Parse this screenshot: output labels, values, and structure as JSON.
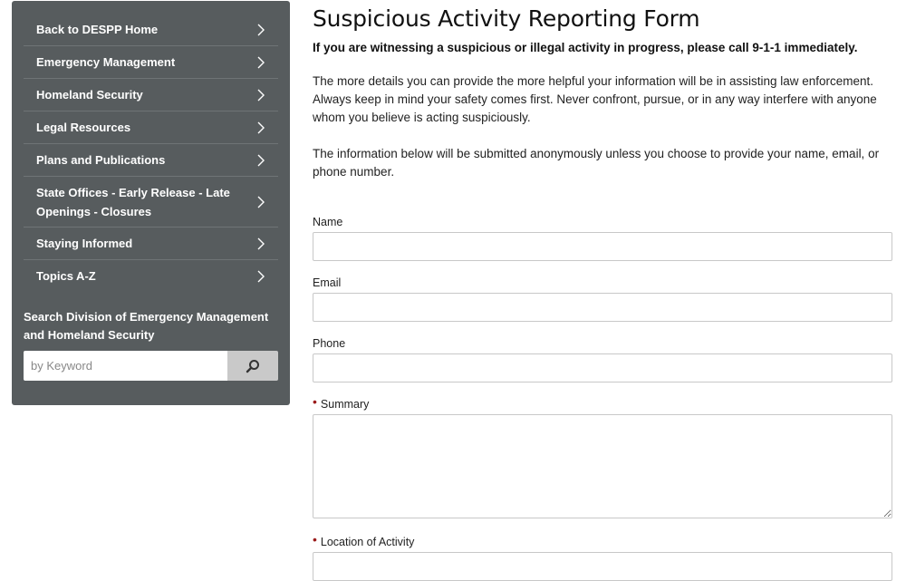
{
  "sidebar": {
    "nav_items": [
      {
        "label": "Back to DESPP Home"
      },
      {
        "label": "Emergency Management"
      },
      {
        "label": "Homeland Security"
      },
      {
        "label": "Legal Resources"
      },
      {
        "label": "Plans and Publications"
      },
      {
        "label": "State Offices - Early Release - Late Openings - Closures"
      },
      {
        "label": "Staying Informed"
      },
      {
        "label": "Topics A-Z"
      }
    ],
    "search": {
      "title": "Search Division of Emergency Management and Homeland Security",
      "placeholder": "by Keyword",
      "value": "",
      "button_icon": "search-icon"
    }
  },
  "main": {
    "title": "Suspicious Activity Reporting Form",
    "warning": "If you are witnessing a suspicious or illegal activity in progress, please call 9-1-1 immediately.",
    "paragraphs": [
      "The more details you can provide the more helpful your information will be in assisting law enforcement. Always keep in mind your safety comes first. Never confront, pursue, or in any way interfere with anyone whom you believe is acting suspiciously.",
      "The information below will be submitted anonymously unless you choose to provide your name, email, or phone number."
    ],
    "fields": {
      "name": {
        "label": "Name",
        "value": "",
        "required": false
      },
      "email": {
        "label": "Email",
        "value": "",
        "required": false
      },
      "phone": {
        "label": "Phone",
        "value": "",
        "required": false
      },
      "summary": {
        "label": "Summary",
        "value": "",
        "required": true
      },
      "location": {
        "label": "Location of Activity",
        "value": "",
        "required": true
      }
    },
    "required_marker": "•"
  },
  "colors": {
    "sidebar_bg": "#575c5e",
    "required_marker": "#9b1b1b",
    "search_button_bg": "#c9c9c9"
  }
}
